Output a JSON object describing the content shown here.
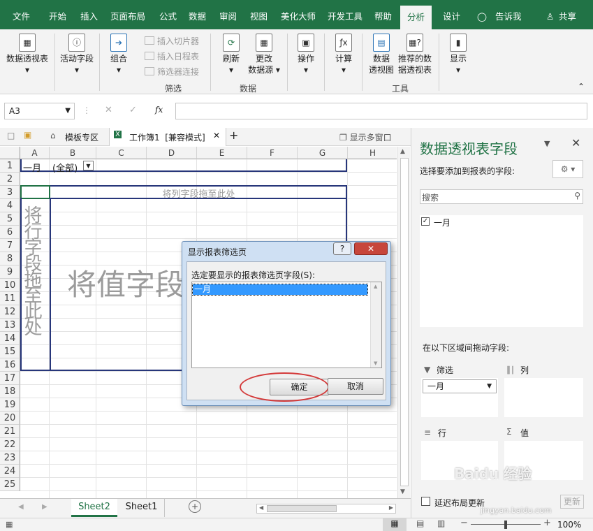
{
  "ribbon_tabs": [
    "文件",
    "开始",
    "插入",
    "页面布局",
    "公式",
    "数据",
    "审阅",
    "视图",
    "美化大师",
    "开发工具",
    "帮助",
    "分析",
    "设计",
    "告诉我",
    "共享"
  ],
  "ribbon": {
    "pivot": "数据透视表",
    "active_field": "活动字段",
    "group": "组合",
    "insert_slicer": "插入切片器",
    "insert_timeline": "插入日程表",
    "filter_conn": "筛选器连接",
    "filter_group": "筛选",
    "refresh": "刷新",
    "change_source_1": "更改",
    "change_source_2": "数据源",
    "data_group": "数据",
    "actions": "操作",
    "calc": "计算",
    "pivotchart_1": "数据",
    "pivotchart_2": "透视图",
    "recommended_1": "推荐的数",
    "recommended_2": "据透视表",
    "tools_group": "工具",
    "show": "显示"
  },
  "formula": {
    "namebox": "A3",
    "fx": "fx"
  },
  "doc_tabs": {
    "template": "模板专区",
    "workbook": "工作簿1  [兼容模式]",
    "multi": "显示多窗口"
  },
  "columns": [
    "A",
    "B",
    "C",
    "D",
    "E",
    "F",
    "G",
    "H"
  ],
  "rows": [
    "1",
    "2",
    "3",
    "4",
    "5",
    "6",
    "7",
    "8",
    "9",
    "10",
    "11",
    "12",
    "13",
    "14",
    "15",
    "16",
    "17",
    "18",
    "19",
    "20",
    "21",
    "22",
    "23",
    "24",
    "25"
  ],
  "cells": {
    "a1": "一月",
    "b1": "(全部)"
  },
  "pivot_placeholders": {
    "col": "将列字段拖至此处",
    "row": "将行字段拖至此处",
    "value": "将值字段拖至此处"
  },
  "sheets": [
    "Sheet2",
    "Sheet1"
  ],
  "status": {
    "zoom": "100%"
  },
  "panel": {
    "title": "数据透视表字段",
    "choose": "选择要添加到报表的字段:",
    "search": "搜索",
    "field": "一月",
    "drag_hint": "在以下区域间拖动字段:",
    "filters": "筛选",
    "columns": "列",
    "rows": "行",
    "values": "值",
    "filter_item": "一月",
    "defer": "延迟布局更新",
    "update": "更新"
  },
  "dialog": {
    "title": "显示报表筛选页",
    "prompt": "选定要显示的报表筛选页字段(S):",
    "item": "一月",
    "ok": "确定",
    "cancel": "取消",
    "help": "?",
    "close": "✕"
  },
  "watermark": {
    "text": "Baidu 经验",
    "url": "jingyan.baidu.com"
  }
}
